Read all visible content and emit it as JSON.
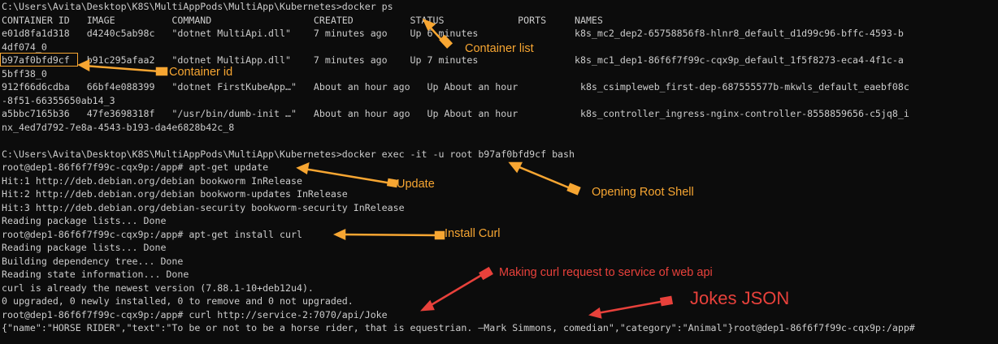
{
  "terminal": {
    "lines": [
      "C:\\Users\\Avita\\Desktop\\K8S\\MultiAppPods\\MultiApp\\Kubernetes>docker ps",
      "CONTAINER ID   IMAGE          COMMAND                  CREATED          STATUS             PORTS     NAMES",
      "e01d8fa1d318   d4240c5ab98c   \"dotnet MultiApi.dll\"    7 minutes ago    Up 6 minutes                 k8s_mc2_dep2-65758856f8-hlnr8_default_d1d99c96-bffc-4593-b",
      "4df074_0",
      "b97af0bfd9cf   b91c295afaa2   \"dotnet MultiApp.dll\"    7 minutes ago    Up 7 minutes                 k8s_mc1_dep1-86f6f7f99c-cqx9p_default_1f5f8273-eca4-4f1c-a",
      "5bff38_0",
      "912f66d6cdba   66bf4e088399   \"dotnet FirstKubeApp…\"   About an hour ago   Up About an hour           k8s_csimpleweb_first-dep-687555577b-mkwls_default_eaebf08c",
      "-8f51-66355650ab14_3",
      "a5bbc7165b36   47fe3698318f   \"/usr/bin/dumb-init …\"   About an hour ago   Up About an hour           k8s_controller_ingress-nginx-controller-8558859656-c5jq8_i",
      "nx_4ed7d792-7e8a-4543-b193-da4e6828b42c_8",
      "",
      "C:\\Users\\Avita\\Desktop\\K8S\\MultiAppPods\\MultiApp\\Kubernetes>docker exec -it -u root b97af0bfd9cf bash",
      "root@dep1-86f6f7f99c-cqx9p:/app# apt-get update",
      "Hit:1 http://deb.debian.org/debian bookworm InRelease",
      "Hit:2 http://deb.debian.org/debian bookworm-updates InRelease",
      "Hit:3 http://deb.debian.org/debian-security bookworm-security InRelease",
      "Reading package lists... Done",
      "root@dep1-86f6f7f99c-cqx9p:/app# apt-get install curl",
      "Reading package lists... Done",
      "Building dependency tree... Done",
      "Reading state information... Done",
      "curl is already the newest version (7.88.1-10+deb12u4).",
      "0 upgraded, 0 newly installed, 0 to remove and 0 not upgraded.",
      "root@dep1-86f6f7f99c-cqx9p:/app# curl http://service-2:7070/api/Joke",
      "{\"name\":\"HORSE RIDER\",\"text\":\"To be or not to be a horse rider, that is equestrian. —Mark Simmons, comedian\",\"category\":\"Animal\"}root@dep1-86f6f7f99c-cqx9p:/app# "
    ]
  },
  "annotations": {
    "container_list": "Container list",
    "container_id": "Container id",
    "update": "Update",
    "opening_root_shell": "Opening Root Shell",
    "install_curl": "Install Curl",
    "curl_request": "Making curl request to service of web api",
    "jokes_json": "Jokes JSON"
  },
  "colors": {
    "background": "#0c0c0c",
    "text": "#cccccc",
    "annotation_orange": "#f7a632",
    "annotation_red": "#e8413b"
  }
}
